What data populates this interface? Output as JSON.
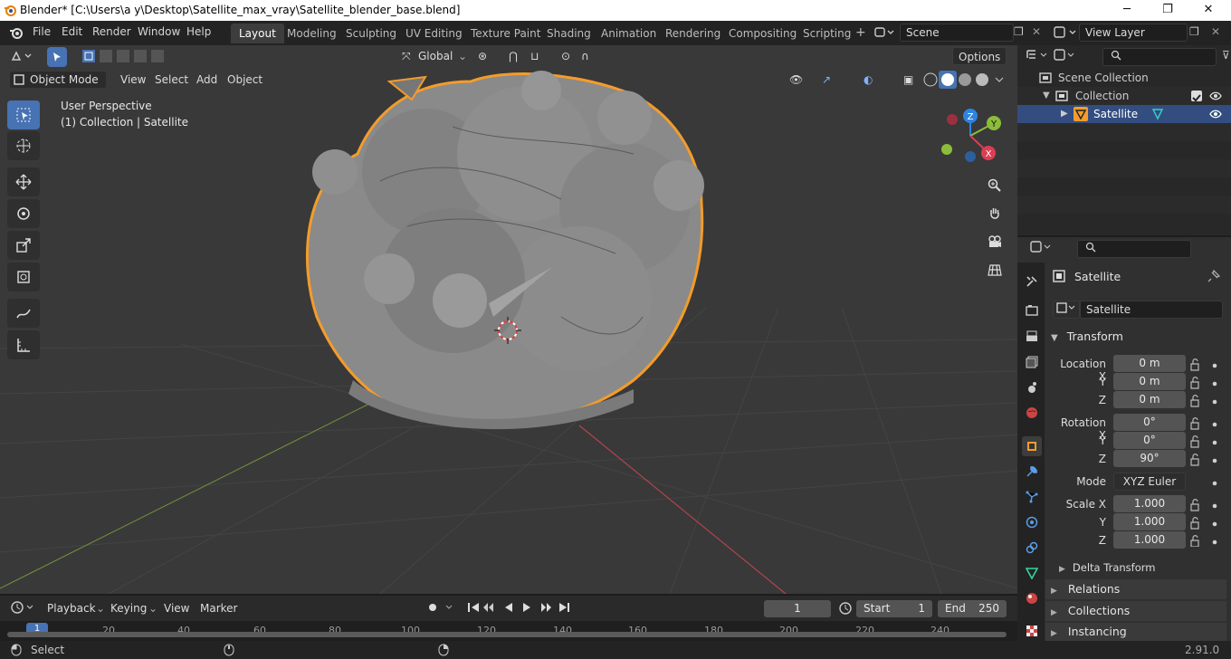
{
  "window": {
    "title": "Blender* [C:\\Users\\a y\\Desktop\\Satellite_max_vray\\Satellite_blender_base.blend]",
    "minimize": "─",
    "maximize": "❐",
    "close": "✕"
  },
  "menu": [
    "File",
    "Edit",
    "Render",
    "Window",
    "Help"
  ],
  "workspaces": [
    "Layout",
    "Modeling",
    "Sculpting",
    "UV Editing",
    "Texture Paint",
    "Shading",
    "Animation",
    "Rendering",
    "Compositing",
    "Scripting"
  ],
  "active_workspace": "Layout",
  "scene_name": "Scene",
  "view_layer": "View Layer",
  "viewport": {
    "mode": "Object Mode",
    "menus": [
      "View",
      "Select",
      "Add",
      "Object"
    ],
    "transform_orientation": "Global",
    "options_label": "Options",
    "perspective_label": "User Perspective",
    "collection_label": "(1) Collection | Satellite",
    "gizmo": {
      "x": "X",
      "y": "Y",
      "z": "Z"
    }
  },
  "outliner": {
    "root": "Scene Collection",
    "collection": "Collection",
    "object": "Satellite"
  },
  "properties": {
    "object_name": "Satellite",
    "data_name": "Satellite",
    "transform_title": "Transform",
    "location_label": "Location X",
    "y_label": "Y",
    "z_label": "Z",
    "location": [
      "0 m",
      "0 m",
      "0 m"
    ],
    "rotation_label": "Rotation X",
    "rotation": [
      "0°",
      "0°",
      "90°"
    ],
    "mode_label": "Mode",
    "mode_value": "XYZ Euler",
    "scale_label": "Scale X",
    "scale": [
      "1.000",
      "1.000",
      "1.000"
    ],
    "delta_transform": "Delta Transform",
    "relations": "Relations",
    "collections": "Collections",
    "instancing": "Instancing"
  },
  "timeline": {
    "menus": [
      "Playback",
      "Keying",
      "View",
      "Marker"
    ],
    "current_frame": "1",
    "start_label": "Start",
    "start": "1",
    "end_label": "End",
    "end": "250",
    "ruler": [
      "1",
      "20",
      "40",
      "60",
      "80",
      "100",
      "120",
      "140",
      "160",
      "180",
      "200",
      "220",
      "240"
    ]
  },
  "status": {
    "left": "Select",
    "version": "2.91.0"
  },
  "colors": {
    "accent": "#4772b3",
    "selection_outline": "#f39c2b",
    "axis_x": "#dd3d52",
    "axis_y": "#8bbd3a",
    "axis_z": "#2f83e0"
  }
}
